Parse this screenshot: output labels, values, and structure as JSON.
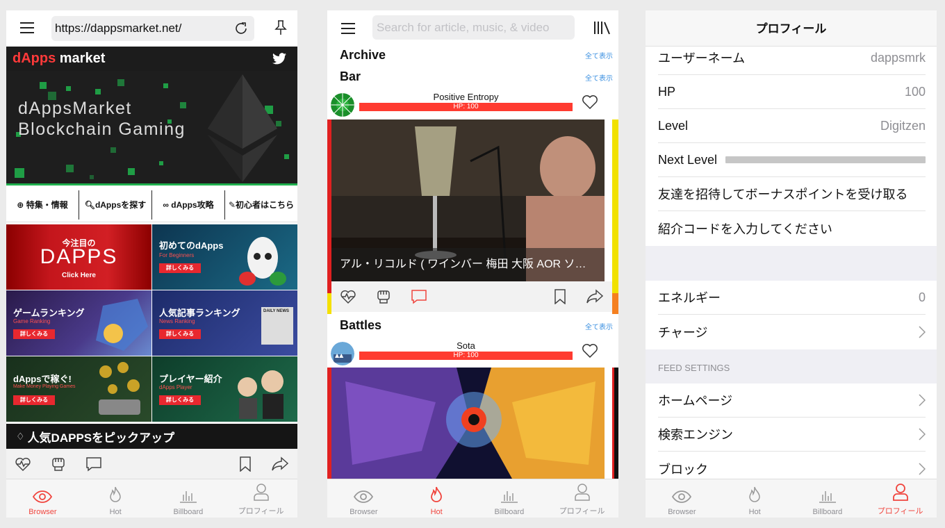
{
  "browser": {
    "url": "https://dappsmarket.net/",
    "site_logo_accent": "dApps",
    "site_logo_rest": " market",
    "banner_line1": "dAppsMarket",
    "banner_line2": "Blockchain Gaming",
    "nav": [
      "特集・情報",
      "dAppsを探す",
      "dApps攻略",
      "初心者はこちら"
    ],
    "tiles": [
      {
        "title": "今注目の",
        "big": "DAPPS",
        "sub": "Click Here"
      },
      {
        "title": "初めてのdApps",
        "sub": "For Beginners",
        "btn": "詳しくみる"
      },
      {
        "title": "ゲームランキング",
        "sub": "Game Ranking",
        "btn": "詳しくみる"
      },
      {
        "title": "人気記事ランキング",
        "sub": "News Ranking",
        "btn": "詳しくみる",
        "tag": "DAILY NEWS"
      },
      {
        "title": "dAppsで稼ぐ!",
        "sub": "Make Money Playing Games",
        "btn": "詳しくみる"
      },
      {
        "title": "プレイヤー紹介",
        "sub": "dApps Player",
        "btn": "詳しくみる"
      }
    ],
    "pickup": "人気DAPPSをピックアップ"
  },
  "hot": {
    "search_placeholder": "Search for article, music, & video",
    "sections": [
      {
        "title": "Archive",
        "show_all": "全て表示"
      },
      {
        "title": "Bar",
        "show_all": "全て表示"
      },
      {
        "title": "Battles",
        "show_all": "全て表示"
      }
    ],
    "cards": [
      {
        "user": "Positive Entropy",
        "hp": "HP: 100",
        "caption": "アル・リコルド ( ワインバー 梅田 大阪 AOR ソ…"
      },
      {
        "user": "Sota",
        "hp": "HP: 100"
      }
    ]
  },
  "profile": {
    "title": "プロフィール",
    "rows": [
      {
        "label": "ユーザーネーム",
        "value": "dappsmrk"
      },
      {
        "label": "HP",
        "value": "100"
      },
      {
        "label": "Level",
        "value": "Digitzen"
      },
      {
        "label": "Next Level",
        "value": ""
      },
      {
        "label": "友達を招待してボーナスポイントを受け取る",
        "value": ""
      },
      {
        "label": "紹介コードを入力してください",
        "value": ""
      }
    ],
    "energy_label": "エネルギー",
    "energy_value": "0",
    "charge_label": "チャージ",
    "feed_header": "FEED SETTINGS",
    "feed_rows": [
      "ホームページ",
      "検索エンジン",
      "ブロック"
    ]
  },
  "tabbar": {
    "tabs": [
      "Browser",
      "Hot",
      "Billboard",
      "プロフィール"
    ]
  },
  "colors": {
    "accent": "#f0443d",
    "link": "#3a8fe0",
    "hp_bar": "#ff3b30"
  }
}
